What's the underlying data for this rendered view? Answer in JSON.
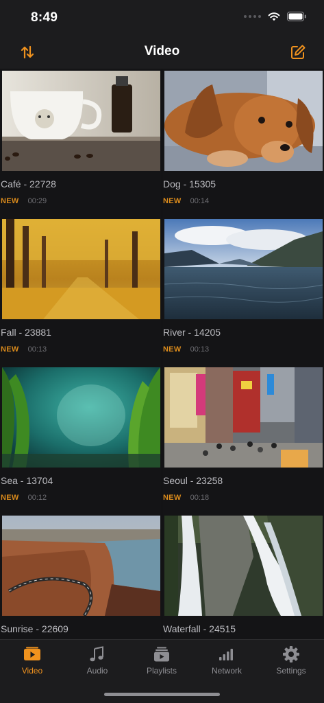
{
  "status": {
    "time": "8:49"
  },
  "header": {
    "title": "Video"
  },
  "colors": {
    "accent": "#f0921e",
    "new_badge": "#d98a1c",
    "background": "#1c1c1e"
  },
  "videos": [
    {
      "title": "Café - 22728",
      "badge": "NEW",
      "duration": "00:29",
      "thumbnail": "coffee-cup-photo"
    },
    {
      "title": "Dog - 15305",
      "badge": "NEW",
      "duration": "00:14",
      "thumbnail": "dog-photo"
    },
    {
      "title": "Fall - 23881",
      "badge": "NEW",
      "duration": "00:13",
      "thumbnail": "autumn-trees-photo"
    },
    {
      "title": "River - 14205",
      "badge": "NEW",
      "duration": "00:13",
      "thumbnail": "lake-mountains-photo"
    },
    {
      "title": "Sea - 13704",
      "badge": "NEW",
      "duration": "00:12",
      "thumbnail": "underwater-kelp-photo"
    },
    {
      "title": "Seoul - 23258",
      "badge": "NEW",
      "duration": "00:18",
      "thumbnail": "city-street-photo"
    },
    {
      "title": "Sunrise - 22609",
      "thumbnail": "coastal-cliff-photo"
    },
    {
      "title": "Waterfall - 24515",
      "thumbnail": "waterfall-photo"
    }
  ],
  "tabs": [
    {
      "label": "Video",
      "icon": "video-icon",
      "active": true
    },
    {
      "label": "Audio",
      "icon": "music-note-icon",
      "active": false
    },
    {
      "label": "Playlists",
      "icon": "playlists-icon",
      "active": false
    },
    {
      "label": "Network",
      "icon": "network-icon",
      "active": false
    },
    {
      "label": "Settings",
      "icon": "gear-icon",
      "active": false
    }
  ]
}
